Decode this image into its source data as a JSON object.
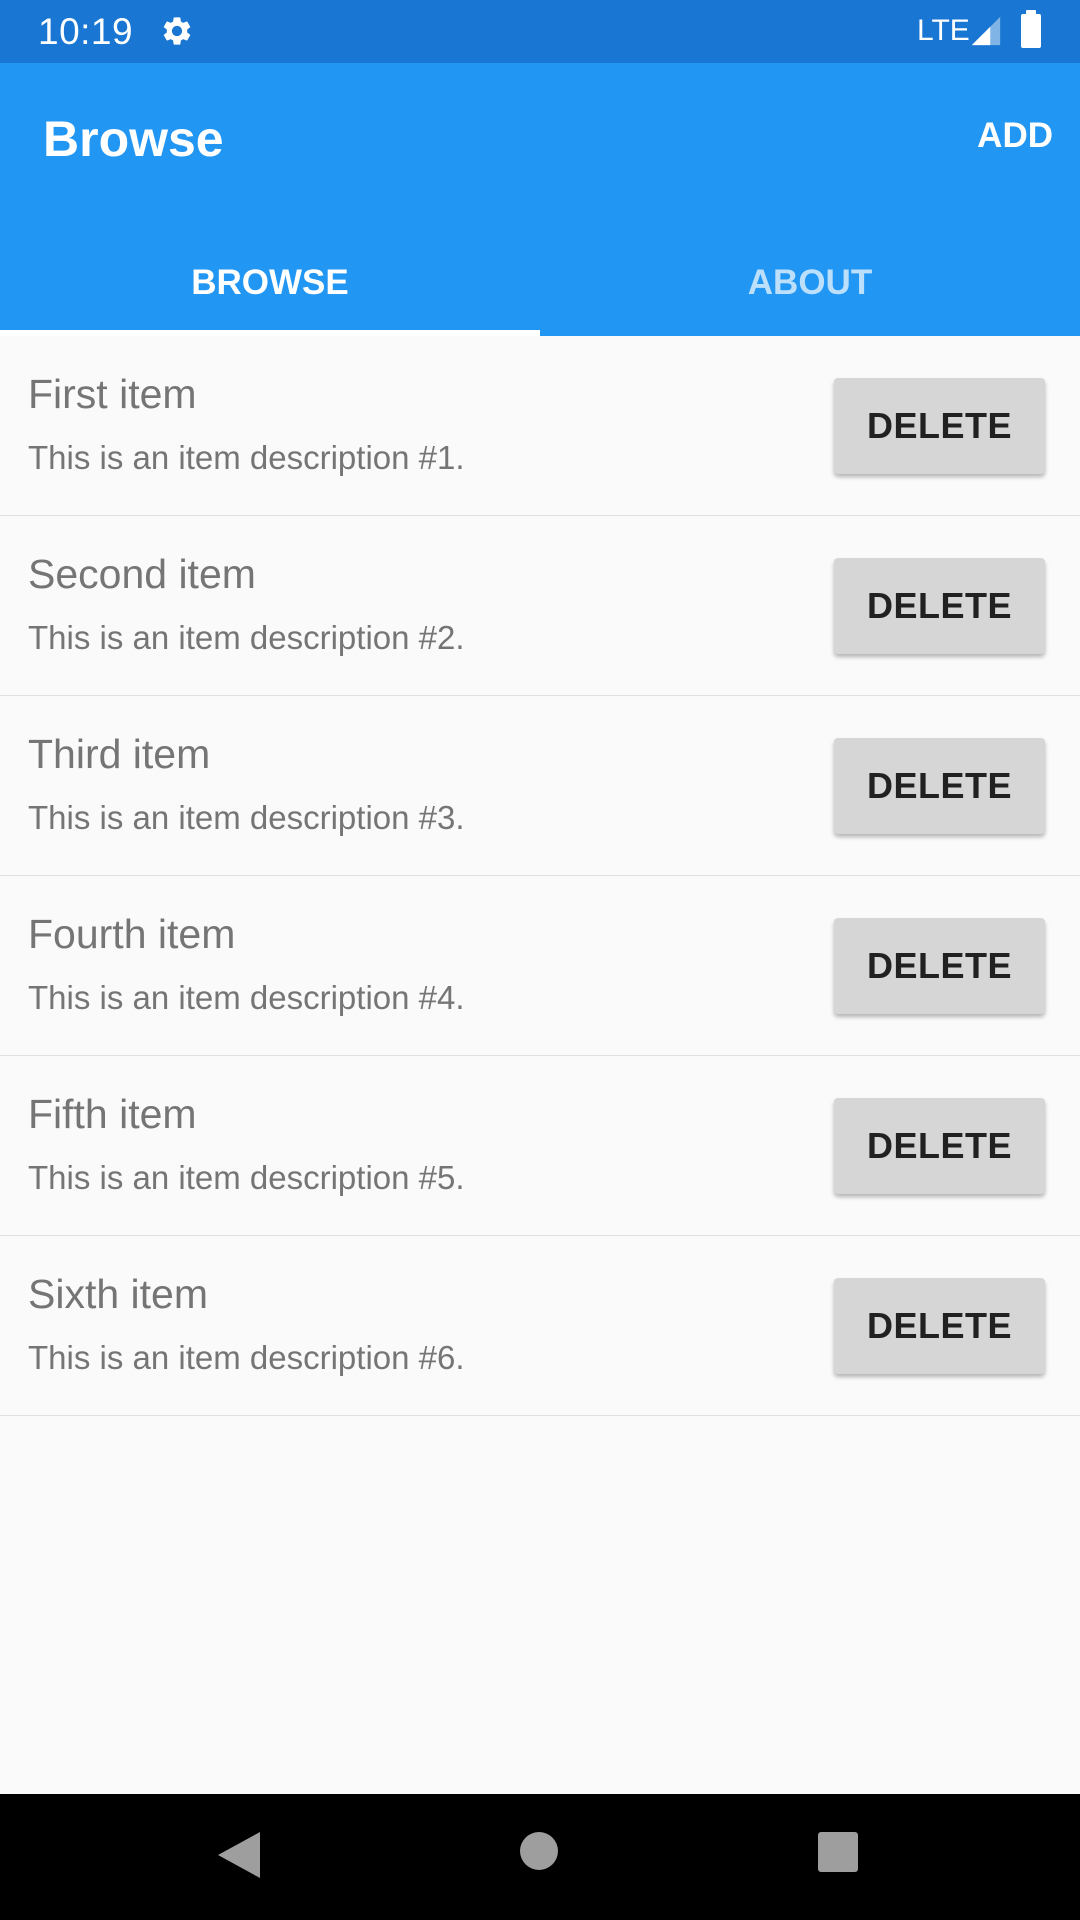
{
  "status_bar": {
    "time": "10:19",
    "network": "LTE",
    "icons": [
      "settings-gear-icon",
      "signal-icon",
      "battery-icon"
    ]
  },
  "app_bar": {
    "title": "Browse",
    "add_label": "ADD",
    "color": "#2196f3"
  },
  "tabs": [
    {
      "label": "BROWSE",
      "active": true
    },
    {
      "label": "ABOUT",
      "active": false
    }
  ],
  "items": [
    {
      "title": "First item",
      "description": "This is an item description #1.",
      "button": "DELETE"
    },
    {
      "title": "Second item",
      "description": "This is an item description #2.",
      "button": "DELETE"
    },
    {
      "title": "Third item",
      "description": "This is an item description #3.",
      "button": "DELETE"
    },
    {
      "title": "Fourth item",
      "description": "This is an item description #4.",
      "button": "DELETE"
    },
    {
      "title": "Fifth item",
      "description": "This is an item description #5.",
      "button": "DELETE"
    },
    {
      "title": "Sixth item",
      "description": "This is an item description #6.",
      "button": "DELETE"
    }
  ],
  "nav_bar": {
    "icons": [
      "back-icon",
      "home-icon",
      "recents-icon"
    ]
  }
}
